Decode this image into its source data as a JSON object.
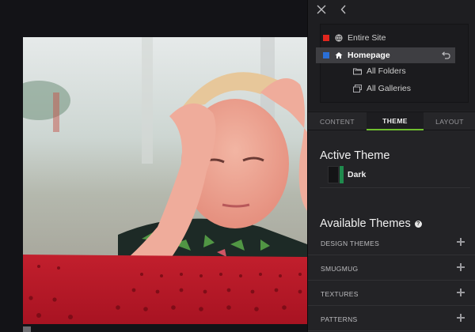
{
  "preview": {
    "photo_alt": ""
  },
  "panel": {
    "tree": {
      "items": [
        {
          "label": "Entire Site",
          "color": "#e0261e",
          "icon": "globe-icon"
        },
        {
          "label": "Homepage",
          "color": "#2a6fd6",
          "icon": "home-icon",
          "selected": true
        },
        {
          "label": "All Folders",
          "icon": "folder-icon"
        },
        {
          "label": "All Galleries",
          "icon": "galleries-icon"
        }
      ]
    },
    "tabs": [
      {
        "label": "CONTENT"
      },
      {
        "label": "THEME",
        "active": true
      },
      {
        "label": "LAYOUT"
      }
    ],
    "active_theme": {
      "heading": "Active Theme",
      "name": "Dark",
      "accent": "#1f8a4d"
    },
    "available_themes": {
      "heading": "Available Themes",
      "help": "?",
      "sections": [
        {
          "label": "DESIGN THEMES"
        },
        {
          "label": "SMUGMUG"
        },
        {
          "label": "TEXTURES"
        },
        {
          "label": "PATTERNS"
        }
      ]
    },
    "colors": {
      "tab_underline": "#6fbf2f",
      "panel_bg": "#232326"
    }
  }
}
